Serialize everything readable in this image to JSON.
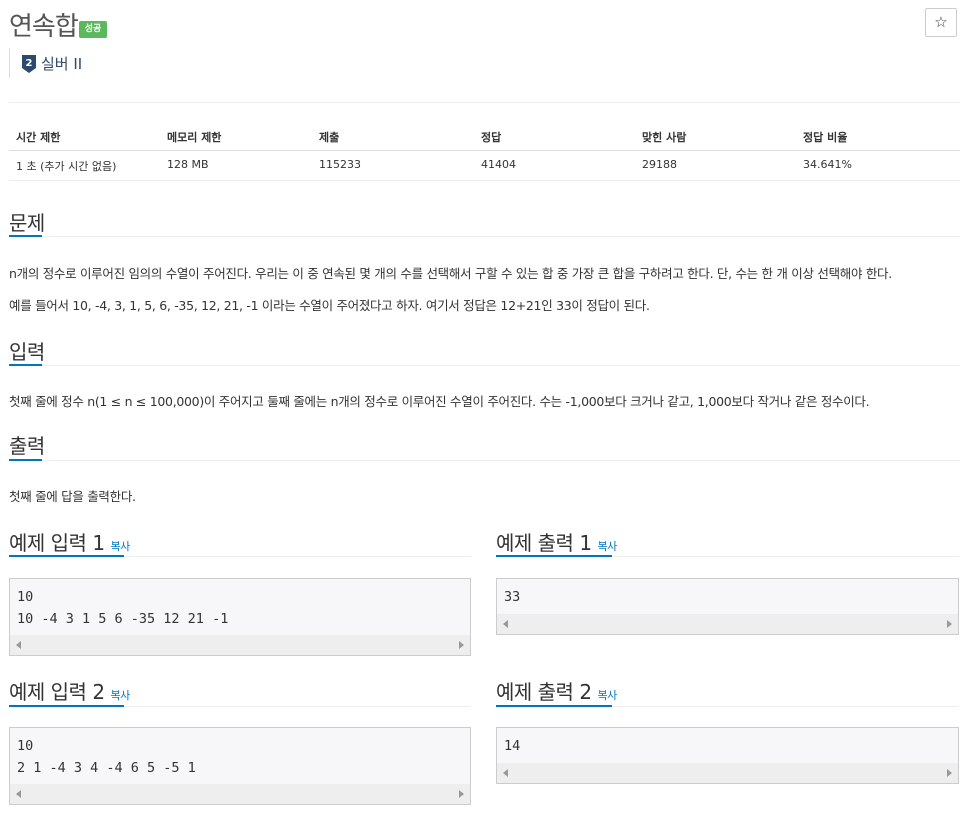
{
  "problem": {
    "title": "연속합",
    "status_badge": "성공",
    "tier": "실버 II",
    "tier_number": "2"
  },
  "stats": {
    "headers": [
      "시간 제한",
      "메모리 제한",
      "제출",
      "정답",
      "맞힌 사람",
      "정답 비율"
    ],
    "values": [
      "1 초 (추가 시간 없음)",
      "128 MB",
      "115233",
      "41404",
      "29188",
      "34.641%"
    ]
  },
  "sections": {
    "problem_heading": "문제",
    "problem_p1": "n개의 정수로 이루어진 임의의 수열이 주어진다. 우리는 이 중 연속된 몇 개의 수를 선택해서 구할 수 있는 합 중 가장 큰 합을 구하려고 한다. 단, 수는 한 개 이상 선택해야 한다.",
    "problem_p2": "예를 들어서 10, -4, 3, 1, 5, 6, -35, 12, 21, -1 이라는 수열이 주어졌다고 하자. 여기서 정답은 12+21인 33이 정답이 된다.",
    "input_heading": "입력",
    "input_p": "첫째 줄에 정수 n(1 ≤ n ≤ 100,000)이 주어지고 둘째 줄에는 n개의 정수로 이루어진 수열이 주어진다. 수는 -1,000보다 크거나 같고, 1,000보다 작거나 같은 정수이다.",
    "output_heading": "출력",
    "output_p": "첫째 줄에 답을 출력한다."
  },
  "samples": {
    "copy_label": "복사",
    "in1_title": "예제 입력 1",
    "in1_l1": "10",
    "in1_l2": "10 -4 3 1 5 6 -35 12 21 -1",
    "out1_title": "예제 출력 1",
    "out1_l1": "33",
    "in2_title": "예제 입력 2",
    "in2_l1": "10",
    "in2_l2": "2 1 -4 3 4 -4 6 5 -5 1",
    "out2_title": "예제 출력 2",
    "out2_l1": "14"
  },
  "icons": {
    "star": "star-icon",
    "tier": "silver-tier-icon"
  },
  "colors": {
    "accent": "#0076c0",
    "success": "#5cb85c",
    "tier": "#2d4a6b"
  }
}
